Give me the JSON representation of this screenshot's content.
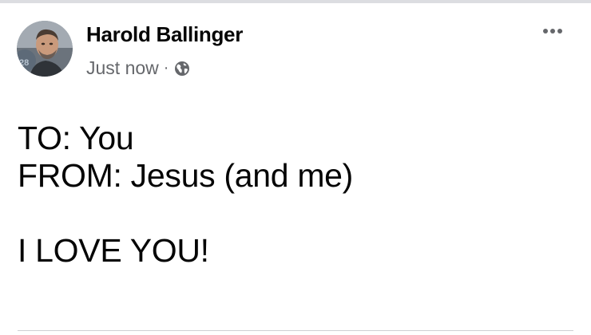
{
  "post": {
    "author": "Harold Ballinger",
    "timestamp": "Just now",
    "separator": "·",
    "privacy_icon": "globe-icon",
    "menu_icon": "more-options-icon",
    "lines": [
      "TO: You",
      "FROM: Jesus (and me)",
      "",
      "I LOVE YOU!"
    ]
  },
  "colors": {
    "text": "#050505",
    "secondary_text": "#65676b",
    "divider": "#ced0d4",
    "top_strip": "#dcdde1"
  }
}
